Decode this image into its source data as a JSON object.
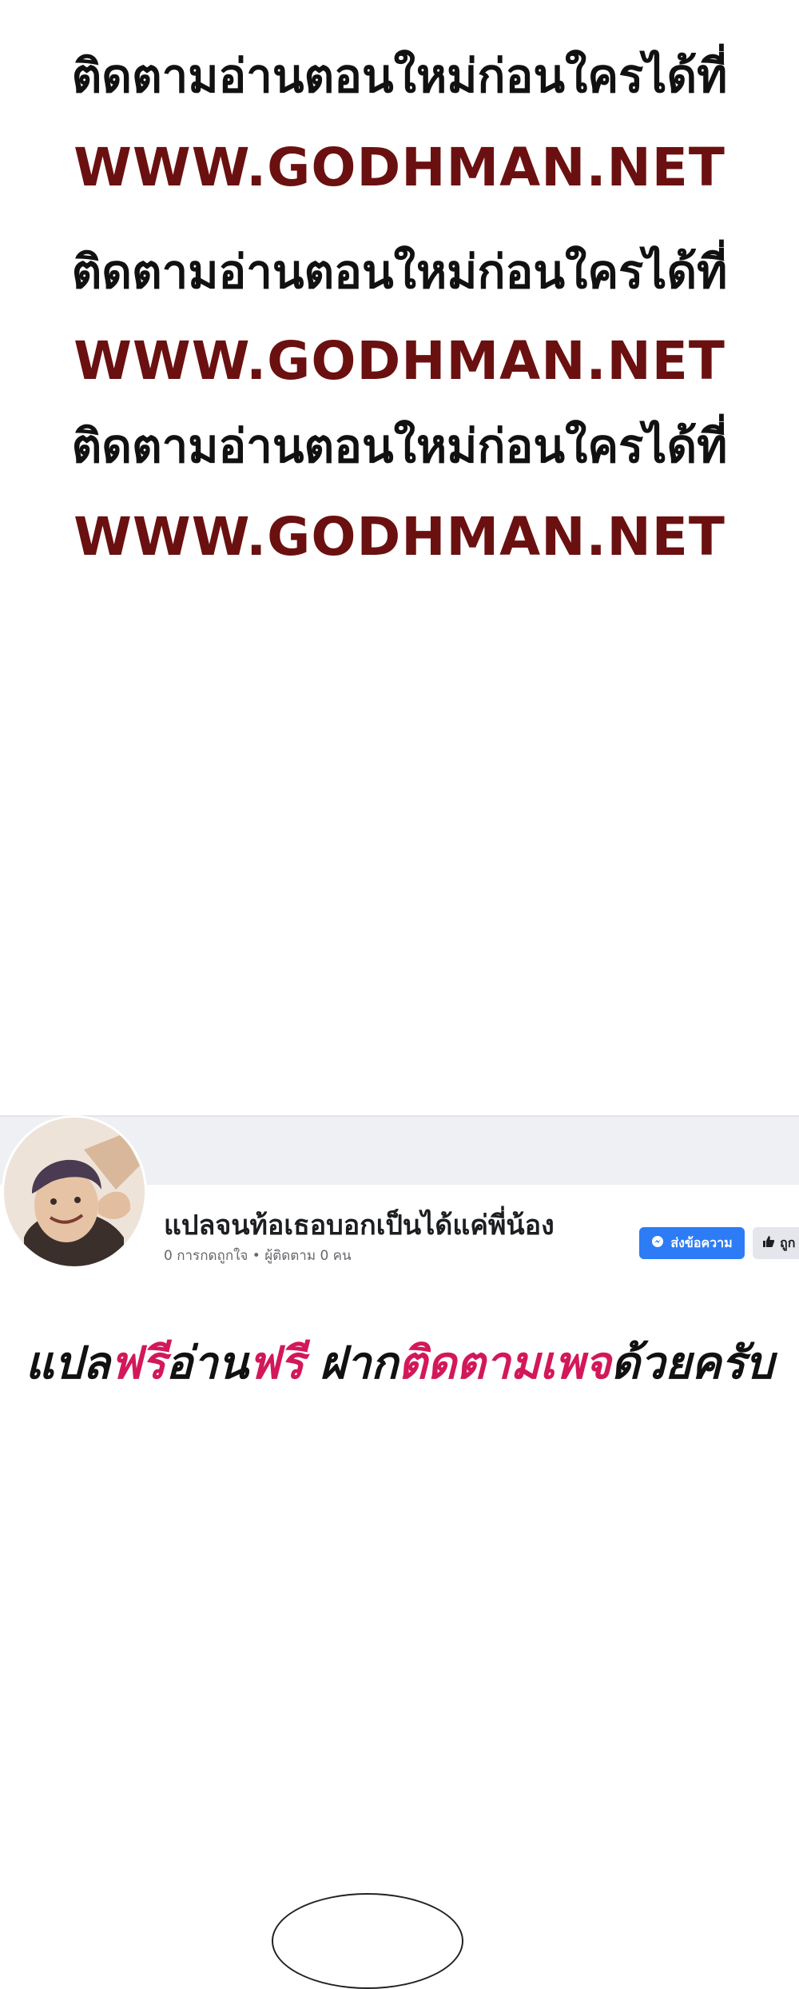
{
  "promo": {
    "line": "ติดตามอ่านตอนใหม่ก่อนใครได้ที่",
    "url": "WWW.GODHMAN.NET"
  },
  "facebook_page": {
    "name": "แปลจนท้อเธอบอกเป็นได้แค่พี่น้อง",
    "stats": "0 การกดถูกใจ • ผู้ติดตาม 0 คน",
    "message_button": "ส่งข้อความ",
    "like_button": "ถูก"
  },
  "cta": {
    "part1": "แปล",
    "part2": "ฟรี",
    "part3": "อ่าน",
    "part4": "ฟรี",
    "part5": " ฝาก",
    "part6": "ติดตามเพจ",
    "part7": "ด้วยครับ"
  },
  "colors": {
    "url_red": "#6b1010",
    "accent_pink": "#d2185a",
    "fb_blue": "#2d7cf5"
  }
}
